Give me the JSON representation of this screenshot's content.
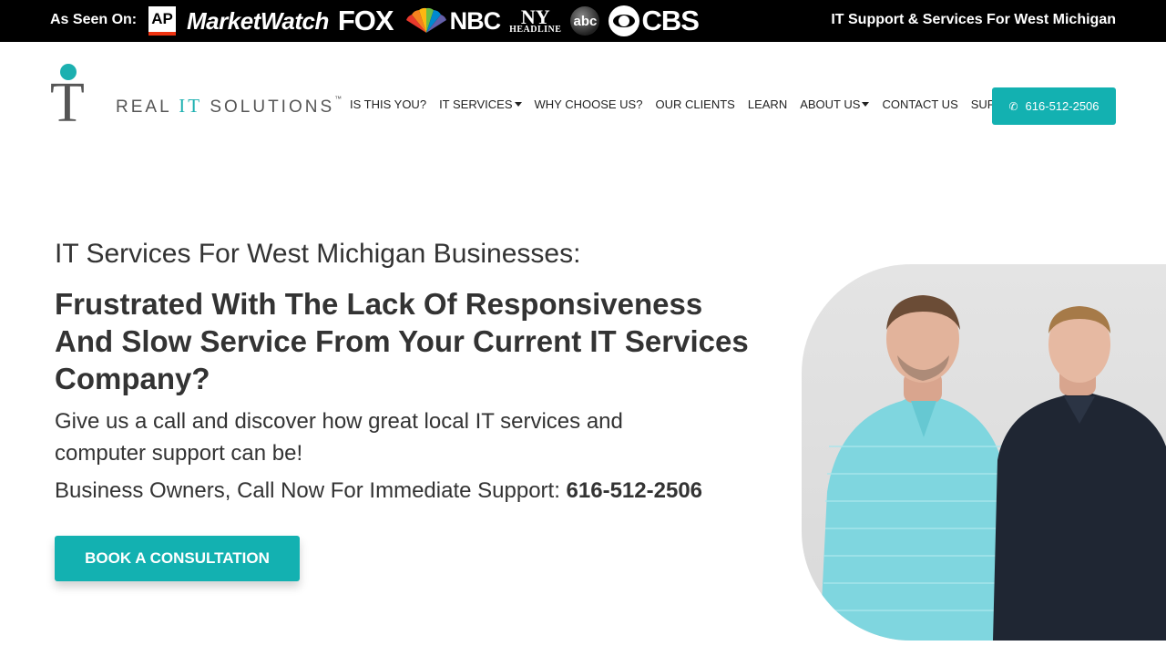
{
  "topbar": {
    "as_seen_label": "As Seen On:",
    "logos": {
      "ap": "AP",
      "marketwatch": "MarketWatch",
      "fox": "FOX",
      "nbc": "NBC",
      "ny_big": "NY",
      "ny_small": "HEADLINE",
      "abc": "abc",
      "cbs": "CBS"
    },
    "tagline": "IT Support & Services For West Michigan"
  },
  "brand": {
    "mark": "T",
    "name_prefix": "REAL ",
    "name_it": "IT",
    "name_suffix": " SOLUTIONS",
    "trademark": "™"
  },
  "nav": {
    "items": [
      {
        "label": "IS THIS YOU?"
      },
      {
        "label": "IT SERVICES"
      },
      {
        "label": "WHY CHOOSE US?"
      },
      {
        "label": "OUR CLIENTS"
      },
      {
        "label": "LEARN"
      },
      {
        "label": "ABOUT US"
      },
      {
        "label": "CONTACT US"
      },
      {
        "label": "SUPPORT"
      }
    ],
    "phone_label": "616-512-2506"
  },
  "hero": {
    "kicker": "IT Services For West Michigan Businesses:",
    "title": "Frustrated With The Lack Of Responsiveness And Slow Service From Your Current IT Services Company?",
    "subtitle": "Give us a call and discover how great local IT services and computer support can be!",
    "call_prefix": "Business Owners, Call Now For Immediate Support: ",
    "call_phone": "616-512-2506",
    "cta_label": "BOOK A CONSULTATION"
  },
  "colors": {
    "accent": "#13b1b1",
    "topbar_bg": "#000000",
    "text": "#333333"
  }
}
